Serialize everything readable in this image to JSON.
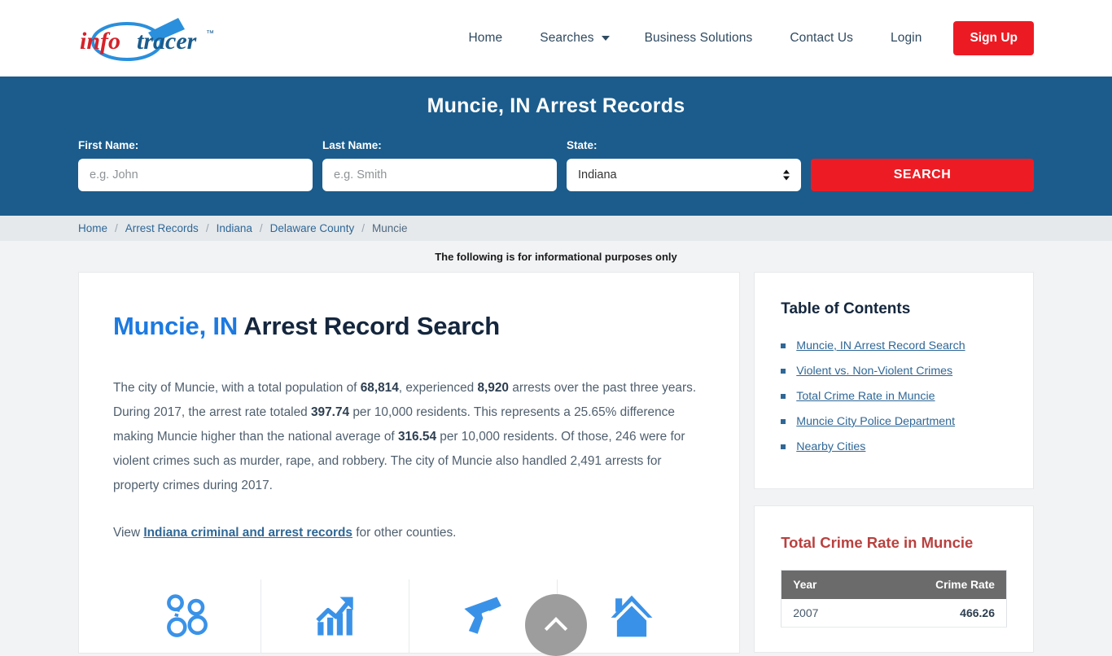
{
  "header": {
    "logo_text": "infotracer",
    "logo_tm": "™",
    "nav": [
      {
        "label": "Home",
        "caret": false
      },
      {
        "label": "Searches",
        "caret": true
      },
      {
        "label": "Business Solutions",
        "caret": false
      },
      {
        "label": "Contact Us",
        "caret": false
      },
      {
        "label": "Login",
        "caret": false
      }
    ],
    "signup_label": "Sign Up",
    "signup_color": "#ec1b23"
  },
  "banner": {
    "title": "Muncie, IN Arrest Records",
    "bg_color": "#1b5c8c",
    "first_name_label": "First Name:",
    "first_name_placeholder": "e.g. John",
    "first_name_value": "",
    "last_name_label": "Last Name:",
    "last_name_placeholder": "e.g. Smith",
    "last_name_value": "",
    "state_label": "State:",
    "state_value": "Indiana",
    "state_options": [
      "Indiana"
    ],
    "search_label": "SEARCH",
    "search_color": "#ed1c24"
  },
  "breadcrumb": {
    "items": [
      "Home",
      "Arrest Records",
      "Indiana",
      "Delaware County",
      "Muncie"
    ],
    "separator": "/"
  },
  "notice": "The following is for informational purposes only",
  "main": {
    "title_highlight": "Muncie, IN",
    "title_rest": " Arrest Record Search",
    "paragraph1": {
      "part1": "The city of Muncie, with a total population of ",
      "b1": "68,814",
      "part2": ", experienced ",
      "b2": "8,920",
      "part3": " arrests over the past three years. During 2017, the arrest rate totaled ",
      "b3": "397.74",
      "part4": " per 10,000 residents. This represents a 25.65% difference making Muncie higher than the national average of ",
      "b4": "316.54",
      "part5": " per 10,000 residents. Of those, 246 were for violent crimes such as murder, rape, and robbery. The city of Muncie also handled 2,491 arrests for property crimes during 2017."
    },
    "paragraph2": {
      "pre": "View ",
      "link": "Indiana criminal and arrest records",
      "post": " for other counties."
    },
    "icons": [
      "handcuffs-icon",
      "growth-chart-icon",
      "handgun-icon",
      "house-icon"
    ]
  },
  "sidebar": {
    "toc_title": "Table of Contents",
    "toc_items": [
      "Muncie, IN Arrest Record Search",
      "Violent vs. Non-Violent Crimes",
      "Total Crime Rate in Muncie",
      "Muncie City Police Department",
      "Nearby Cities"
    ],
    "crime_card_title": "Total Crime Rate in Muncie",
    "crime_table": {
      "columns": [
        "Year",
        "Crime Rate"
      ],
      "rows": [
        {
          "year": "2007",
          "rate": "466.26"
        }
      ]
    }
  },
  "scroll_top": {
    "icon": "chevron-up-icon",
    "color": "#9d9d9d"
  }
}
